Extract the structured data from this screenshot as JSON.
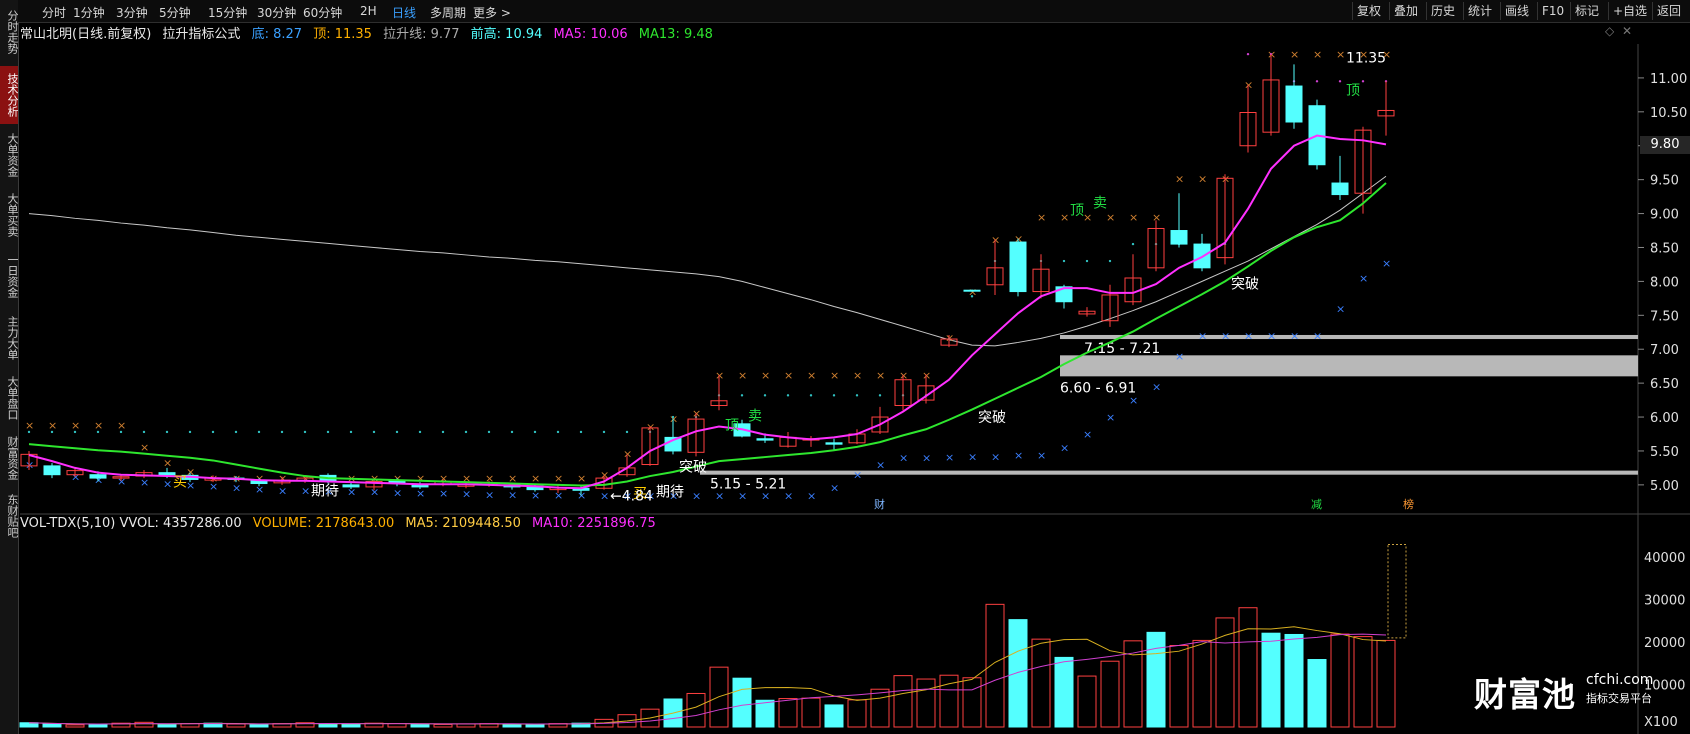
{
  "left_tabs": [
    {
      "label": "分时走势",
      "top": 0
    },
    {
      "label": "技术分析",
      "top": 66,
      "active": true
    },
    {
      "label": "大单资金",
      "top": 126
    },
    {
      "label": "大单买卖",
      "top": 186
    },
    {
      "label": "一日资金",
      "top": 246
    },
    {
      "label": "主力大单",
      "top": 308
    },
    {
      "label": "大单盘口",
      "top": 370
    },
    {
      "label": "财富资金",
      "top": 428
    },
    {
      "label": "东财贴吧",
      "top": 490
    }
  ],
  "period_tabs": [
    "分时",
    "1分钟",
    "3分钟",
    "5分钟",
    "15分钟",
    "30分钟",
    "60分钟",
    "2H",
    "日线",
    "多周期",
    "更多 >"
  ],
  "active_period": "日线",
  "right_buttons": [
    "复权",
    "叠加",
    "历史",
    "统计",
    "画线",
    "F10",
    "标记",
    "+自选",
    "返回"
  ],
  "info": {
    "stock": "常山北明(日线.前复权)",
    "indicator": "拉升指标公式",
    "bottom": "底: 8.27",
    "top": "顶: 11.35",
    "lift_line": "拉升线: 9.77",
    "prev_high": "前高: 10.94",
    "ma5": "MA5: 10.06",
    "ma13": "MA13: 9.48"
  },
  "vol_info": {
    "name": "VOL-TDX(5,10) VVOL: 4357286.00",
    "volume": "VOLUME: 2178643.00",
    "ma5": "MA5: 2109448.50",
    "ma10": "MA10: 2251896.75"
  },
  "price_axis": [
    "11.00",
    "10.50",
    "10.00",
    "9.50",
    "9.00",
    "8.50",
    "8.00",
    "7.50",
    "7.00",
    "6.50",
    "6.00",
    "5.50",
    "5.00"
  ],
  "vol_axis": [
    "40000",
    "30000",
    "20000",
    "10000"
  ],
  "vol_unit": "X100",
  "current_price_tag": "9.80",
  "zones": [
    {
      "label": "7.15 - 7.21",
      "lo": 7.15,
      "hi": 7.21
    },
    {
      "label": "6.60 - 6.91",
      "lo": 6.6,
      "hi": 6.91
    },
    {
      "label": "5.15 - 5.21",
      "lo": 5.15,
      "hi": 5.21
    }
  ],
  "chart_data": {
    "type": "candlestick",
    "ylim": [
      4.6,
      11.5
    ],
    "vol_ylim": [
      0,
      45000
    ],
    "candles": [
      [
        5.28,
        5.45,
        5.5,
        5.22
      ],
      [
        5.28,
        5.15,
        5.32,
        5.1
      ],
      [
        5.15,
        5.21,
        5.25,
        5.12
      ],
      [
        5.15,
        5.1,
        5.2,
        5.05
      ],
      [
        5.1,
        5.12,
        5.16,
        5.06
      ],
      [
        5.13,
        5.18,
        5.22,
        5.1
      ],
      [
        5.18,
        5.15,
        5.25,
        5.1
      ],
      [
        5.14,
        5.08,
        5.18,
        5.04
      ],
      [
        5.07,
        5.1,
        5.14,
        5.04
      ],
      [
        5.1,
        5.08,
        5.13,
        5.04
      ],
      [
        5.06,
        5.02,
        5.1,
        4.98
      ],
      [
        5.03,
        5.07,
        5.12,
        5.0
      ],
      [
        5.06,
        5.1,
        5.14,
        5.03
      ],
      [
        5.14,
        5.06,
        5.17,
        5.02
      ],
      [
        5.0,
        4.97,
        5.03,
        4.94
      ],
      [
        4.97,
        5.05,
        5.08,
        4.92
      ],
      [
        5.06,
        5.02,
        5.1,
        4.98
      ],
      [
        5.0,
        4.97,
        5.04,
        4.94
      ],
      [
        5.01,
        5.05,
        5.08,
        4.98
      ],
      [
        4.98,
        5.01,
        5.05,
        4.95
      ],
      [
        5.0,
        5.03,
        5.06,
        4.97
      ],
      [
        5.0,
        4.97,
        5.03,
        4.93
      ],
      [
        4.98,
        4.93,
        5.0,
        4.9
      ],
      [
        4.93,
        4.96,
        5.0,
        4.88
      ],
      [
        4.95,
        4.92,
        4.98,
        4.84
      ],
      [
        4.95,
        5.1,
        5.14,
        4.93
      ],
      [
        5.15,
        5.25,
        5.45,
        5.12
      ],
      [
        5.3,
        5.84,
        5.86,
        5.28
      ],
      [
        5.7,
        5.5,
        5.98,
        5.45
      ],
      [
        5.48,
        5.97,
        6.06,
        5.42
      ],
      [
        6.17,
        6.24,
        6.62,
        6.1
      ],
      [
        5.9,
        5.72,
        5.96,
        5.7
      ],
      [
        5.68,
        5.66,
        5.76,
        5.62
      ],
      [
        5.57,
        5.7,
        5.78,
        5.55
      ],
      [
        5.66,
        5.68,
        5.72,
        5.56
      ],
      [
        5.62,
        5.6,
        5.68,
        5.5
      ],
      [
        5.62,
        5.75,
        5.82,
        5.6
      ],
      [
        5.78,
        6.0,
        6.15,
        5.75
      ],
      [
        6.17,
        6.55,
        6.62,
        6.1
      ],
      [
        6.25,
        6.46,
        6.63,
        6.2
      ],
      [
        7.06,
        7.15,
        7.21,
        7.03
      ],
      [
        7.87,
        7.86,
        7.88,
        7.85
      ],
      [
        7.95,
        8.2,
        8.62,
        7.8
      ],
      [
        8.58,
        7.85,
        8.63,
        7.78
      ],
      [
        7.85,
        8.18,
        8.4,
        7.75
      ],
      [
        7.92,
        7.7,
        7.95,
        7.6
      ],
      [
        7.52,
        7.56,
        7.62,
        7.48
      ],
      [
        7.42,
        7.8,
        7.95,
        7.33
      ],
      [
        7.7,
        8.05,
        8.4,
        7.65
      ],
      [
        8.2,
        8.78,
        8.9,
        8.15
      ],
      [
        8.75,
        8.55,
        9.3,
        8.5
      ],
      [
        8.55,
        8.2,
        8.7,
        8.15
      ],
      [
        8.35,
        9.52,
        9.58,
        8.25
      ],
      [
        10.0,
        10.49,
        10.9,
        9.9
      ],
      [
        10.2,
        10.97,
        11.35,
        10.15
      ],
      [
        10.88,
        10.35,
        11.2,
        10.25
      ],
      [
        10.59,
        9.72,
        10.68,
        9.65
      ],
      [
        9.45,
        9.28,
        9.85,
        9.2
      ],
      [
        9.3,
        10.23,
        10.28,
        9.0
      ],
      [
        10.44,
        10.52,
        10.95,
        10.15
      ]
    ],
    "volumes": [
      [
        1000,
        0
      ],
      [
        700,
        0
      ],
      [
        500,
        1
      ],
      [
        600,
        0
      ],
      [
        900,
        1
      ],
      [
        1100,
        1
      ],
      [
        600,
        0
      ],
      [
        800,
        1
      ],
      [
        900,
        0
      ],
      [
        700,
        1
      ],
      [
        600,
        0
      ],
      [
        800,
        1
      ],
      [
        1000,
        1
      ],
      [
        700,
        0
      ],
      [
        700,
        0
      ],
      [
        900,
        1
      ],
      [
        800,
        1
      ],
      [
        700,
        0
      ],
      [
        600,
        1
      ],
      [
        700,
        1
      ],
      [
        800,
        1
      ],
      [
        700,
        0
      ],
      [
        600,
        0
      ],
      [
        800,
        1
      ],
      [
        900,
        0
      ],
      [
        1800,
        1
      ],
      [
        2900,
        1
      ],
      [
        4200,
        1
      ],
      [
        6600,
        0
      ],
      [
        7900,
        1
      ],
      [
        14100,
        1
      ],
      [
        11500,
        0
      ],
      [
        6300,
        0
      ],
      [
        6700,
        1
      ],
      [
        6800,
        1
      ],
      [
        5200,
        0
      ],
      [
        6400,
        1
      ],
      [
        8900,
        1
      ],
      [
        12100,
        1
      ],
      [
        11300,
        1
      ],
      [
        12200,
        1
      ],
      [
        11600,
        1
      ],
      [
        28900,
        1
      ],
      [
        25300,
        0
      ],
      [
        20700,
        1
      ],
      [
        16400,
        0
      ],
      [
        12000,
        1
      ],
      [
        15500,
        1
      ],
      [
        20300,
        1
      ],
      [
        22300,
        0
      ],
      [
        19200,
        1
      ],
      [
        20400,
        1
      ],
      [
        25700,
        1
      ],
      [
        28100,
        1
      ],
      [
        22100,
        0
      ],
      [
        21800,
        0
      ],
      [
        15900,
        0
      ],
      [
        21900,
        1
      ],
      [
        21300,
        1
      ],
      [
        20400,
        1
      ]
    ],
    "ma5": [
      5.44,
      5.35,
      5.25,
      5.18,
      5.15,
      5.14,
      5.13,
      5.12,
      5.1,
      5.09,
      5.07,
      5.06,
      5.06,
      5.05,
      5.04,
      5.03,
      5.02,
      5.01,
      5.01,
      5.01,
      5.0,
      4.99,
      4.98,
      4.96,
      4.95,
      5.05,
      5.25,
      5.5,
      5.66,
      5.79,
      5.86,
      5.82,
      5.74,
      5.7,
      5.67,
      5.7,
      5.75,
      5.89,
      6.08,
      6.31,
      6.55,
      6.91,
      7.22,
      7.53,
      7.78,
      7.9,
      7.9,
      7.83,
      7.83,
      7.96,
      8.2,
      8.36,
      8.57,
      9.07,
      9.66,
      10.0,
      10.15,
      10.1,
      10.08,
      10.02
    ],
    "ma13": [
      5.6,
      5.57,
      5.54,
      5.51,
      5.49,
      5.46,
      5.43,
      5.4,
      5.36,
      5.3,
      5.24,
      5.18,
      5.13,
      5.1,
      5.09,
      5.08,
      5.07,
      5.06,
      5.05,
      5.04,
      5.03,
      5.02,
      5.01,
      5.0,
      4.99,
      5.0,
      5.05,
      5.13,
      5.19,
      5.27,
      5.35,
      5.38,
      5.41,
      5.44,
      5.47,
      5.51,
      5.56,
      5.63,
      5.73,
      5.82,
      5.96,
      6.11,
      6.27,
      6.43,
      6.59,
      6.78,
      6.95,
      7.1,
      7.26,
      7.45,
      7.63,
      7.81,
      8.0,
      8.22,
      8.45,
      8.65,
      8.8,
      8.9,
      9.15,
      9.45
    ],
    "ma_long": [
      9.0,
      8.97,
      8.93,
      8.9,
      8.86,
      8.83,
      8.79,
      8.76,
      8.72,
      8.68,
      8.65,
      8.62,
      8.59,
      8.56,
      8.53,
      8.5,
      8.47,
      8.44,
      8.42,
      8.39,
      8.36,
      8.34,
      8.31,
      8.29,
      8.26,
      8.23,
      8.2,
      8.17,
      8.14,
      8.11,
      8.07,
      8.0,
      7.91,
      7.82,
      7.73,
      7.63,
      7.54,
      7.44,
      7.34,
      7.24,
      7.14,
      7.06,
      7.05,
      7.1,
      7.16,
      7.24,
      7.34,
      7.45,
      7.57,
      7.7,
      7.85,
      8.0,
      8.15,
      8.3,
      8.48,
      8.66,
      8.84,
      9.05,
      9.3,
      9.55
    ],
    "cross_top": [
      5.88,
      5.88,
      5.88,
      5.88,
      5.88,
      5.56,
      5.33,
      5.2,
      5.1,
      5.1,
      5.1,
      5.1,
      5.1,
      5.1,
      5.1,
      5.1,
      5.1,
      5.1,
      5.1,
      5.1,
      5.1,
      5.1,
      5.1,
      5.1,
      5.1,
      5.15,
      5.46,
      5.86,
      5.98,
      6.06,
      6.62,
      6.62,
      6.62,
      6.62,
      6.62,
      6.62,
      6.62,
      6.62,
      6.62,
      6.62,
      7.17,
      7.85,
      8.62,
      8.63,
      8.95,
      8.95,
      8.95,
      8.95,
      8.95,
      8.95,
      9.52,
      9.52,
      9.52,
      10.9,
      11.35,
      11.35,
      11.35,
      11.35,
      11.35,
      11.35
    ],
    "cross_bottom": [
      5.3,
      5.2,
      5.12,
      5.08,
      5.06,
      5.04,
      5.02,
      5.0,
      4.98,
      4.96,
      4.94,
      4.92,
      4.92,
      4.91,
      4.9,
      4.9,
      4.89,
      4.88,
      4.88,
      4.87,
      4.86,
      4.86,
      4.85,
      4.85,
      4.85,
      4.84,
      4.84,
      4.84,
      4.84,
      4.84,
      4.84,
      4.84,
      4.84,
      4.84,
      4.84,
      4.96,
      5.15,
      5.3,
      5.4,
      5.4,
      5.41,
      5.42,
      5.42,
      5.44,
      5.44,
      5.55,
      5.75,
      6.0,
      6.25,
      6.45,
      6.9,
      7.2,
      7.2,
      7.2,
      7.2,
      7.2,
      7.2,
      7.6,
      8.05,
      8.27
    ],
    "dots": [
      5.78,
      5.78,
      5.78,
      5.78,
      5.78,
      5.78,
      5.78,
      5.78,
      5.78,
      5.78,
      5.78,
      5.78,
      5.78,
      5.78,
      5.78,
      5.78,
      5.78,
      5.78,
      5.78,
      5.78,
      5.78,
      5.78,
      5.78,
      5.78,
      5.78,
      5.78,
      5.78,
      5.78,
      6.0,
      6.0,
      6.32,
      6.32,
      6.32,
      6.32,
      6.32,
      6.32,
      6.32,
      6.32,
      6.32,
      6.32,
      7.15,
      7.78,
      8.3,
      8.3,
      8.3,
      8.3,
      8.3,
      8.3,
      8.55,
      8.55,
      8.55,
      8.55,
      8.55,
      11.35,
      11.35,
      10.95,
      10.95,
      10.95,
      10.95,
      10.95
    ],
    "markers": [
      {
        "text": "买",
        "i": 6,
        "y": 5.05,
        "color": "#ffcc00"
      },
      {
        "text": "期待",
        "i": 12,
        "y": 4.92,
        "color": "#ffffff"
      },
      {
        "text": "期待",
        "i": 27,
        "y": 4.9,
        "color": "#ffffff"
      },
      {
        "text": "买",
        "i": 26,
        "y": 4.88,
        "color": "#ffcc00"
      },
      {
        "text": "←4.84",
        "i": 25,
        "y": 4.84,
        "color": "#ffffff"
      },
      {
        "text": "突破",
        "i": 28,
        "y": 5.27,
        "color": "#ffffff"
      },
      {
        "text": "突破",
        "i": 41,
        "y": 6.0,
        "color": "#ffffff"
      },
      {
        "text": "突破",
        "i": 52,
        "y": 7.97,
        "color": "#ffffff"
      },
      {
        "text": "卖",
        "i": 31,
        "y": 6.02,
        "color": "#22dd44"
      },
      {
        "text": "顶",
        "i": 30,
        "y": 5.88,
        "color": "#22dd44"
      },
      {
        "text": "卖",
        "i": 46,
        "y": 9.16,
        "color": "#22dd44"
      },
      {
        "text": "顶",
        "i": 45,
        "y": 9.05,
        "color": "#22dd44"
      },
      {
        "text": "顶",
        "i": 57,
        "y": 10.82,
        "color": "#22dd44"
      },
      {
        "text": "11.35",
        "i": 57,
        "y": 11.3,
        "color": "#ffffff"
      }
    ],
    "bottom_labels": [
      {
        "text": "财",
        "i": 37,
        "color": "#7fb6ff"
      },
      {
        "text": "减",
        "i": 56,
        "color": "#22dd44"
      },
      {
        "text": "榜",
        "i": 60,
        "color": "#ff9933"
      }
    ]
  },
  "watermark": {
    "brand": "财富池",
    "url": "cfchi.com",
    "sub": "指标交易平台"
  },
  "colors": {
    "up": "#ff4040",
    "down": "#54ffff",
    "ma5": "#ff30ff",
    "ma13": "#2ee62e",
    "ma_long": "#c8c8c8",
    "info_bottom": "#3aa0ff",
    "info_top": "#ffb000"
  }
}
